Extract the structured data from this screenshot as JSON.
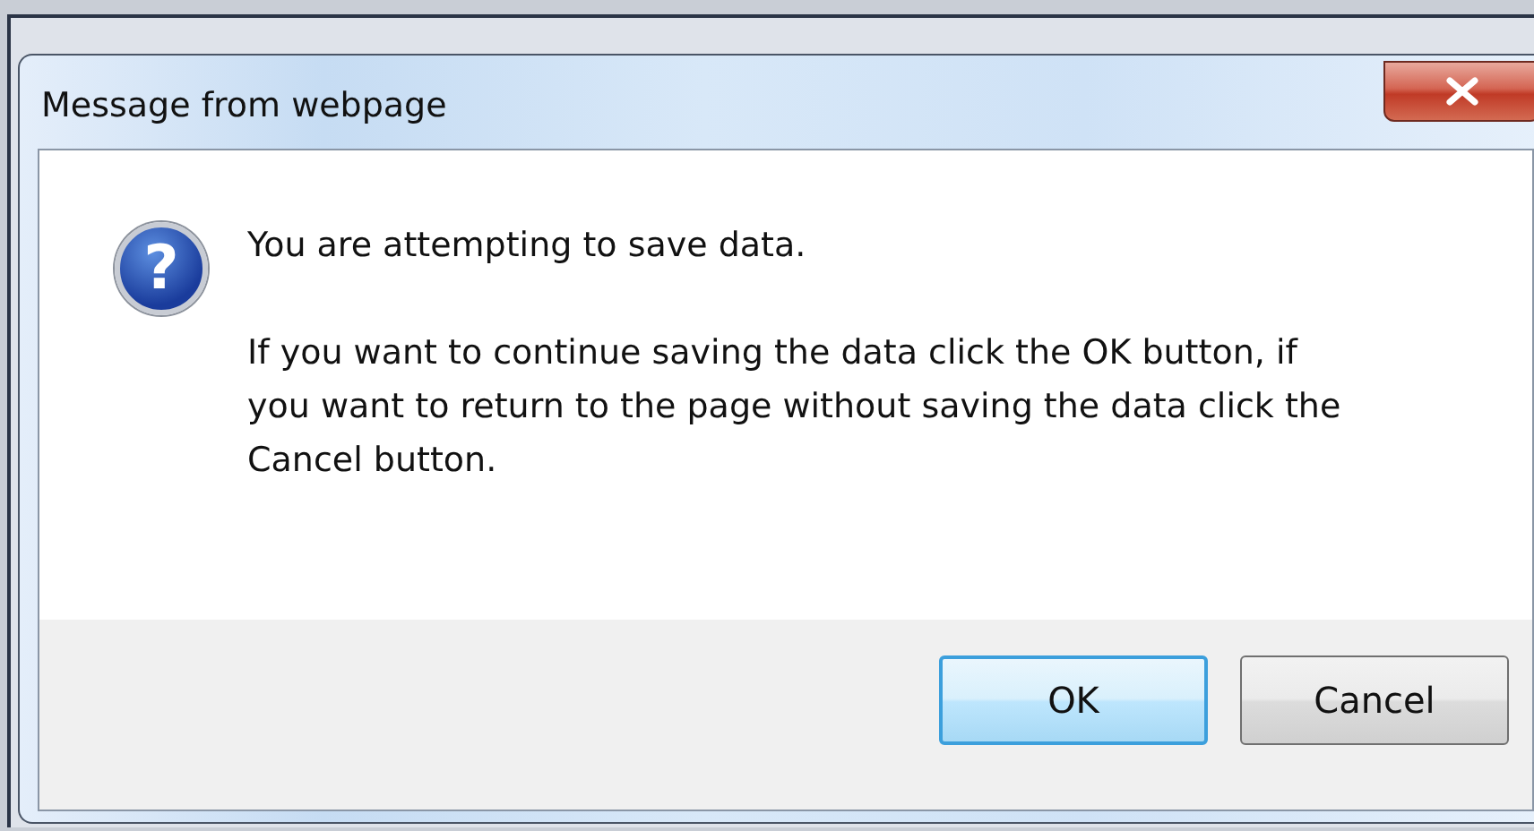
{
  "window": {
    "title": "Message from webpage"
  },
  "icon": {
    "glyph": "?"
  },
  "message": {
    "lines": [
      "You are attempting to save data.",
      "If you want to continue saving the data click the OK button, if you want to return to the page without saving the data click the Cancel button."
    ]
  },
  "buttons": [
    {
      "label": "OK",
      "focused": true
    },
    {
      "label": "Cancel",
      "focused": false
    }
  ]
}
